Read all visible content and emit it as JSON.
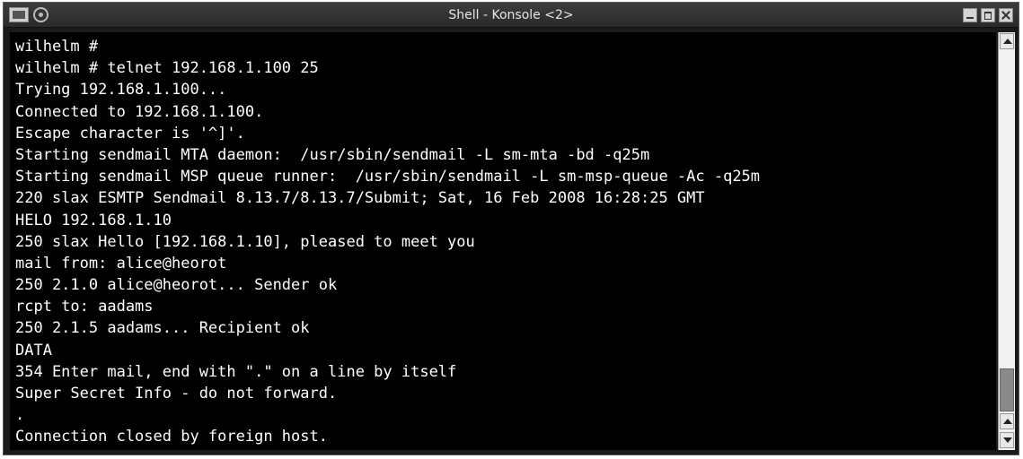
{
  "window": {
    "title": "Shell - Konsole <2>"
  },
  "terminal": {
    "lines": [
      "wilhelm #",
      "wilhelm # telnet 192.168.1.100 25",
      "Trying 192.168.1.100...",
      "Connected to 192.168.1.100.",
      "Escape character is '^]'.",
      "Starting sendmail MTA daemon:  /usr/sbin/sendmail -L sm-mta -bd -q25m",
      "Starting sendmail MSP queue runner:  /usr/sbin/sendmail -L sm-msp-queue -Ac -q25m",
      "220 slax ESMTP Sendmail 8.13.7/8.13.7/Submit; Sat, 16 Feb 2008 16:28:25 GMT",
      "HELO 192.168.1.10",
      "250 slax Hello [192.168.1.10], pleased to meet you",
      "mail from: alice@heorot",
      "250 2.1.0 alice@heorot... Sender ok",
      "rcpt to: aadams",
      "250 2.1.5 aadams... Recipient ok",
      "DATA",
      "354 Enter mail, end with \".\" on a line by itself",
      "Super Secret Info - do not forward.",
      ".",
      "Connection closed by foreign host."
    ]
  },
  "colors": {
    "terminal_bg": "#000000",
    "terminal_fg": "#ffffff",
    "titlebar_bg": "#333333"
  },
  "icons": {
    "app": "konsole-icon",
    "sticky": "sticky-icon",
    "minimize": "minimize-icon",
    "maximize": "maximize-icon",
    "close": "close-icon"
  }
}
